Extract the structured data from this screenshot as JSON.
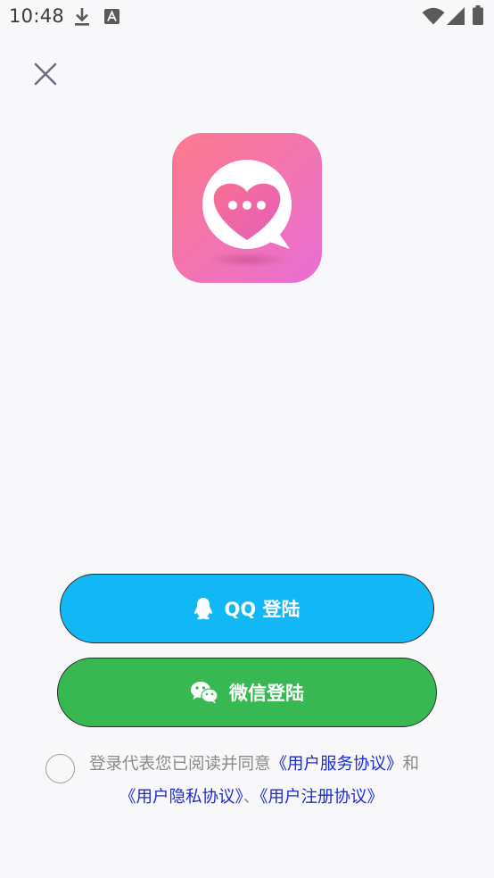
{
  "status_bar": {
    "time": "10:48",
    "icons": [
      "download-icon",
      "keyboard-a-icon",
      "wifi-icon",
      "signal-icon",
      "battery-icon"
    ]
  },
  "header": {
    "close_icon": "close-icon"
  },
  "logo": {
    "icon": "heart-chat-bubble-icon",
    "colors": {
      "gradient_start": "#fd7a8c",
      "gradient_end": "#e86ed4"
    }
  },
  "login": {
    "qq_label": "QQ 登陆",
    "qq_icon": "qq-penguin-icon",
    "qq_color": "#12b7f5",
    "wechat_label": "微信登陆",
    "wechat_icon": "wechat-icon",
    "wechat_color": "#37b852"
  },
  "agreement": {
    "checked": false,
    "prefix": "登录代表您已阅读并同意",
    "service_link": "《用户服务协议》",
    "and_text": "和",
    "privacy_link": "《用户隐私协议》",
    "separator": "、",
    "register_link": "《用户注册协议》",
    "link_color": "#1a2bd8"
  }
}
